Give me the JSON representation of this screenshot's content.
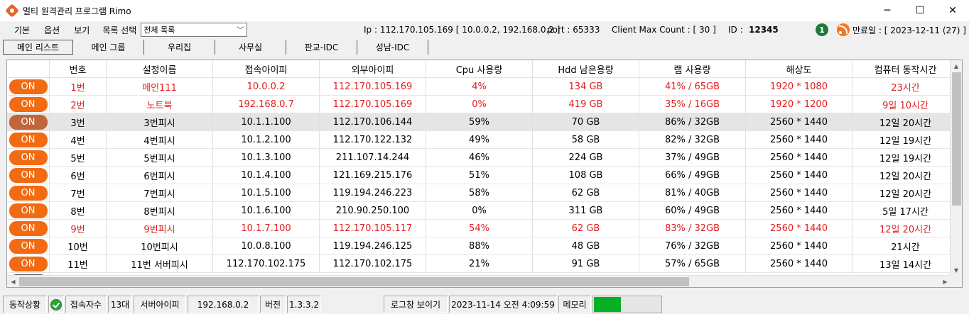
{
  "window": {
    "title": "멀티 원격관리 프로그램 Rimo",
    "minimize": "─",
    "maximize": "☐",
    "close": "✕"
  },
  "menu": {
    "items": [
      "기본",
      "옵션",
      "보기"
    ],
    "select_label": "목록 선택",
    "select_value": "전체 목록"
  },
  "info": {
    "ip": "Ip : 112.170.105.169 [ 10.0.0.2, 192.168.0.2 ]",
    "port": "port : 65333",
    "client_max": "Client Max Count :  [ 30 ]",
    "id_label": "ID :",
    "id_value": "12345",
    "badge_count": "1",
    "expiry": "만료일 : [ 2023-12-11 (27) ]"
  },
  "tabs": [
    "메인 리스트",
    "메인 그룹",
    "우리집",
    "사무실",
    "판교-IDC",
    "성남-IDC"
  ],
  "grid": {
    "headers": [
      "",
      "번호",
      "설정이름",
      "접속아이피",
      "외부아이피",
      "Cpu 사용량",
      "Hdd 남은용량",
      "램 사용량",
      "해상도",
      "컴퓨터 동작시간"
    ],
    "rows": [
      {
        "status": "ON",
        "num": "1번",
        "name": "메인111",
        "ip": "10.0.0.2",
        "ext_ip": "112.170.105.169",
        "cpu": "4%",
        "hdd": "134 GB",
        "ram": "41% / 65GB",
        "res": "1920 * 1080",
        "uptime": "23시간",
        "red": true
      },
      {
        "status": "ON",
        "num": "2번",
        "name": "노트북",
        "ip": "192.168.0.7",
        "ext_ip": "112.170.105.169",
        "cpu": "0%",
        "hdd": "419 GB",
        "ram": "35% / 16GB",
        "res": "1920 * 1200",
        "uptime": "9일 10시간",
        "red": true
      },
      {
        "status": "ON",
        "num": "3번",
        "name": "3번피시",
        "ip": "10.1.1.100",
        "ext_ip": "112.170.106.144",
        "cpu": "59%",
        "hdd": "70 GB",
        "ram": "86% / 32GB",
        "res": "2560 * 1440",
        "uptime": "12일 20시간",
        "selected": true
      },
      {
        "status": "ON",
        "num": "4번",
        "name": "4번피시",
        "ip": "10.1.2.100",
        "ext_ip": "112.170.122.132",
        "cpu": "49%",
        "hdd": "58 GB",
        "ram": "82% / 32GB",
        "res": "2560 * 1440",
        "uptime": "12일 19시간"
      },
      {
        "status": "ON",
        "num": "5번",
        "name": "5번피시",
        "ip": "10.1.3.100",
        "ext_ip": "211.107.14.244",
        "cpu": "46%",
        "hdd": "224 GB",
        "ram": "37% / 49GB",
        "res": "2560 * 1440",
        "uptime": "12일 19시간"
      },
      {
        "status": "ON",
        "num": "6번",
        "name": "6번피시",
        "ip": "10.1.4.100",
        "ext_ip": "121.169.215.176",
        "cpu": "51%",
        "hdd": "108 GB",
        "ram": "66% / 49GB",
        "res": "2560 * 1440",
        "uptime": "12일 20시간"
      },
      {
        "status": "ON",
        "num": "7번",
        "name": "7번피시",
        "ip": "10.1.5.100",
        "ext_ip": "119.194.246.223",
        "cpu": "58%",
        "hdd": "62 GB",
        "ram": "81% / 40GB",
        "res": "2560 * 1440",
        "uptime": "12일 20시간"
      },
      {
        "status": "ON",
        "num": "8번",
        "name": "8번피시",
        "ip": "10.1.6.100",
        "ext_ip": "210.90.250.100",
        "cpu": "0%",
        "hdd": "311 GB",
        "ram": "60% / 49GB",
        "res": "2560 * 1440",
        "uptime": "5일 17시간"
      },
      {
        "status": "ON",
        "num": "9번",
        "name": "9번피시",
        "ip": "10.1.7.100",
        "ext_ip": "112.170.105.117",
        "cpu": "54%",
        "hdd": "62 GB",
        "ram": "83% / 32GB",
        "res": "2560 * 1440",
        "uptime": "12일 20시간",
        "red": true
      },
      {
        "status": "ON",
        "num": "10번",
        "name": "10번피시",
        "ip": "10.0.8.100",
        "ext_ip": "119.194.246.125",
        "cpu": "88%",
        "hdd": "48 GB",
        "ram": "76% / 32GB",
        "res": "2560 * 1440",
        "uptime": "21시간"
      },
      {
        "status": "ON",
        "num": "11번",
        "name": "11번 서버피시",
        "ip": "112.170.102.175",
        "ext_ip": "112.170.102.175",
        "cpu": "21%",
        "hdd": "91 GB",
        "ram": "57% / 65GB",
        "res": "2560 * 1440",
        "uptime": "13일 14시간"
      }
    ]
  },
  "status": {
    "state_label": "동작상황",
    "clients_label": "접속자수",
    "clients_value": "13대",
    "server_ip_label": "서버아이피",
    "server_ip_value": "192.168.0.2",
    "version_label": "버전",
    "version_value": "1.3.3.2",
    "log_button": "로그창 보이기",
    "datetime": "2023-11-14 오전 4:09:59",
    "memory_label": "메모리",
    "memory_level": 0.4
  },
  "colors": {
    "on_button": "#f26a12",
    "alert_text": "#e02020",
    "memory_fill": "#06b025"
  }
}
